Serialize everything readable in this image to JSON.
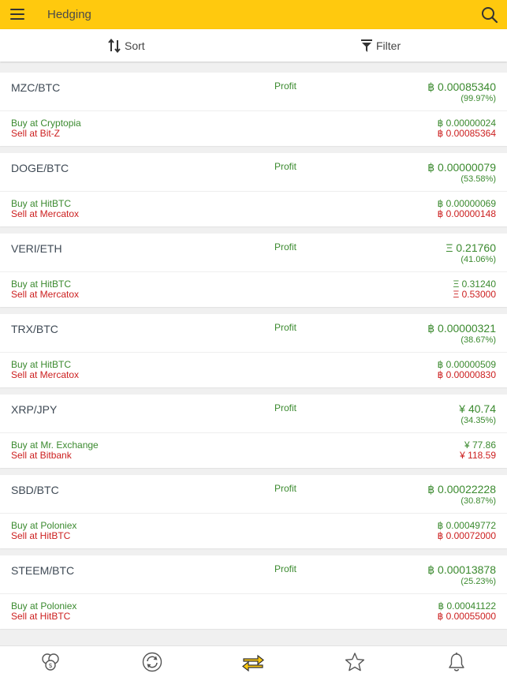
{
  "header": {
    "title": "Hedging"
  },
  "toolbar": {
    "sort_label": "Sort",
    "filter_label": "Filter"
  },
  "colors": {
    "accent": "#ffc90e",
    "profit": "#3b8a2f",
    "sell": "#cc1f1f"
  },
  "items": [
    {
      "pair": "MZC/BTC",
      "profit_label": "Profit",
      "profit": "฿ 0.00085340",
      "percent": "(99.97%)",
      "buy": "Buy at Cryptopia",
      "sell": "Sell at Bit-Z",
      "buy_price": "฿ 0.00000024",
      "sell_price": "฿ 0.00085364"
    },
    {
      "pair": "DOGE/BTC",
      "profit_label": "Profit",
      "profit": "฿ 0.00000079",
      "percent": "(53.58%)",
      "buy": "Buy at HitBTC",
      "sell": "Sell at Mercatox",
      "buy_price": "฿ 0.00000069",
      "sell_price": "฿ 0.00000148"
    },
    {
      "pair": "VERI/ETH",
      "profit_label": "Profit",
      "profit": "Ξ 0.21760",
      "percent": "(41.06%)",
      "buy": "Buy at HitBTC",
      "sell": "Sell at Mercatox",
      "buy_price": "Ξ 0.31240",
      "sell_price": "Ξ 0.53000"
    },
    {
      "pair": "TRX/BTC",
      "profit_label": "Profit",
      "profit": "฿ 0.00000321",
      "percent": "(38.67%)",
      "buy": "Buy at HitBTC",
      "sell": "Sell at Mercatox",
      "buy_price": "฿ 0.00000509",
      "sell_price": "฿ 0.00000830"
    },
    {
      "pair": "XRP/JPY",
      "profit_label": "Profit",
      "profit": "¥ 40.74",
      "percent": "(34.35%)",
      "buy": "Buy at Mr. Exchange",
      "sell": "Sell at Bitbank",
      "buy_price": "¥ 77.86",
      "sell_price": "¥ 118.59"
    },
    {
      "pair": "SBD/BTC",
      "profit_label": "Profit",
      "profit": "฿ 0.00022228",
      "percent": "(30.87%)",
      "buy": "Buy at Poloniex",
      "sell": "Sell at HitBTC",
      "buy_price": "฿ 0.00049772",
      "sell_price": "฿ 0.00072000"
    },
    {
      "pair": "STEEM/BTC",
      "profit_label": "Profit",
      "profit": "฿ 0.00013878",
      "percent": "(25.23%)",
      "buy": "Buy at Poloniex",
      "sell": "Sell at HitBTC",
      "buy_price": "฿ 0.00041122",
      "sell_price": "฿ 0.00055000"
    }
  ],
  "bottom_nav": [
    {
      "icon": "coins-icon"
    },
    {
      "icon": "refresh-icon"
    },
    {
      "icon": "exchange-arrows-icon",
      "active": true
    },
    {
      "icon": "star-icon"
    },
    {
      "icon": "bell-icon"
    }
  ]
}
